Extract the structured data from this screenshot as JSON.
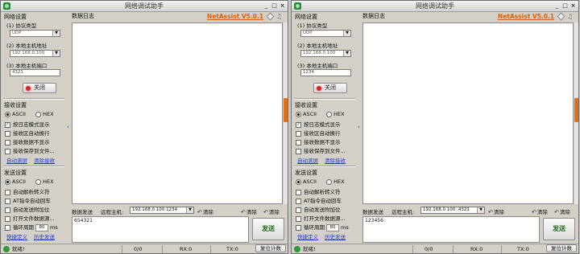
{
  "windows": [
    {
      "title": "网络调试助手",
      "brand": "NetAssist V5.0.1",
      "network": {
        "title": "网络设置",
        "protocol_label": "(1) 协议类型",
        "protocol_value": "UDP",
        "local_ip_label": "(2) 本地主机地址",
        "local_ip_value": "192.168.0.100",
        "local_port_label": "(3) 本地主机端口",
        "local_port_value": "4321",
        "connect_label": "关闭"
      },
      "receive": {
        "title": "接收设置",
        "ascii": "ASCII",
        "hex": "HEX",
        "options": [
          "按日志模式显示",
          "接收区自动换行",
          "接收数据不显示",
          "接收保存到文件..."
        ],
        "links": [
          "自动滚屏",
          "清除接收"
        ]
      },
      "send": {
        "title": "发送设置",
        "ascii": "ASCII",
        "hex": "HEX",
        "options": [
          "自动解析转义符",
          "AT指令自动回车",
          "自动发送附加位",
          "打开文件数据源..."
        ],
        "cycle_label": "循环周期",
        "cycle_value": "80",
        "cycle_unit": "ms",
        "links": [
          "快捷定义",
          "历史发送"
        ]
      },
      "log_tab": "数据日志",
      "send_bar": {
        "data_send_label": "数据发送",
        "remote_label": "远程主机:",
        "remote_value": "192.168.0.100:1234",
        "clear1": "清除",
        "clear2": "清除"
      },
      "send_text": "654321",
      "send_button": "发送",
      "status": {
        "ready": "就绪!",
        "counter1": "0/0",
        "rx": "RX:0",
        "tx": "TX:0",
        "reset": "复位计数"
      }
    },
    {
      "title": "网络调试助手",
      "brand": "NetAssist V5.0.1",
      "network": {
        "title": "网络设置",
        "protocol_label": "(1) 协议类型",
        "protocol_value": "UDP",
        "local_ip_label": "(2) 本地主机地址",
        "local_ip_value": "192.168.0.100",
        "local_port_label": "(3) 本地主机端口",
        "local_port_value": "1234",
        "connect_label": "关闭"
      },
      "receive": {
        "title": "接收设置",
        "ascii": "ASCII",
        "hex": "HEX",
        "options": [
          "按日志模式显示",
          "接收区自动换行",
          "接收数据不显示",
          "接收保存到文件..."
        ],
        "links": [
          "自动滚屏",
          "清除接收"
        ]
      },
      "send": {
        "title": "发送设置",
        "ascii": "ASCII",
        "hex": "HEX",
        "options": [
          "自动解析转义符",
          "AT指令自动回车",
          "自动发送附加位",
          "打开文件数据源..."
        ],
        "cycle_label": "循环周期",
        "cycle_value": "80",
        "cycle_unit": "ms",
        "links": [
          "快捷定义",
          "历史发送"
        ]
      },
      "log_tab": "数据日志",
      "send_bar": {
        "data_send_label": "数据发送",
        "remote_label": "远程主机:",
        "remote_value": "192.168.0.100 :4321",
        "clear1": "清除",
        "clear2": "清除"
      },
      "send_text": "123456",
      "send_button": "发送",
      "status": {
        "ready": "就绪!",
        "counter1": "0/0",
        "rx": "RX:0",
        "tx": "TX:0",
        "reset": "复位计数"
      }
    }
  ]
}
